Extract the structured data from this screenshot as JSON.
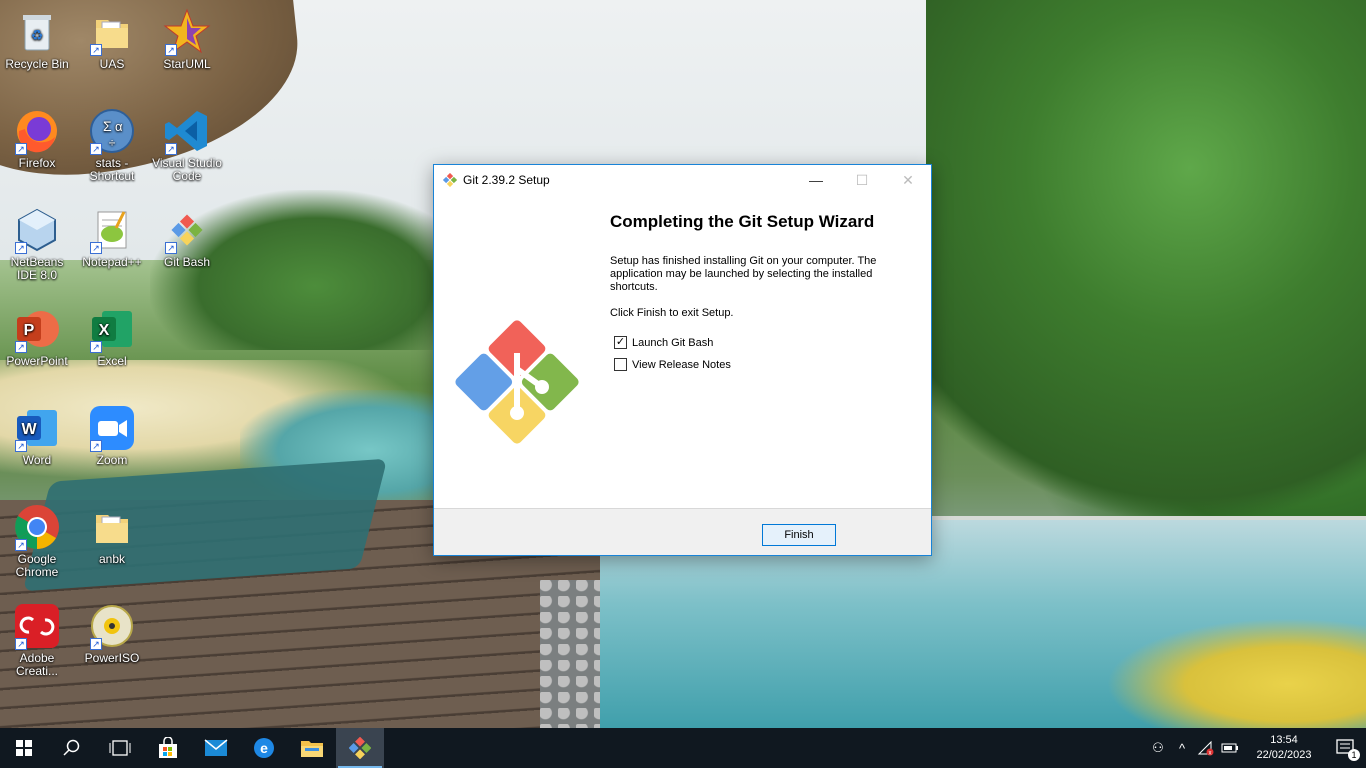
{
  "desktop": {
    "icons": [
      {
        "label": "Recycle Bin",
        "icon": "recycle-bin-icon"
      },
      {
        "label": "UAS",
        "icon": "folder-icon"
      },
      {
        "label": "StarUML",
        "icon": "staruml-icon"
      },
      {
        "label": "Firefox",
        "icon": "firefox-icon"
      },
      {
        "label": "stats - Shortcut",
        "icon": "stats-icon"
      },
      {
        "label": "Visual Studio Code",
        "icon": "vscode-icon"
      },
      {
        "label": "NetBeans IDE 8.0",
        "icon": "netbeans-icon"
      },
      {
        "label": "Notepad++",
        "icon": "notepadpp-icon"
      },
      {
        "label": "Git Bash",
        "icon": "git-bash-icon"
      },
      {
        "label": "PowerPoint",
        "icon": "powerpoint-icon"
      },
      {
        "label": "Excel",
        "icon": "excel-icon"
      },
      {
        "label": "Word",
        "icon": "word-icon"
      },
      {
        "label": "Zoom",
        "icon": "zoom-icon"
      },
      {
        "label": "Google Chrome",
        "icon": "chrome-icon"
      },
      {
        "label": "anbk",
        "icon": "folder-icon"
      },
      {
        "label": "Adobe Creati...",
        "icon": "adobe-cc-icon"
      },
      {
        "label": "PowerISO",
        "icon": "poweriso-icon"
      }
    ]
  },
  "dialog": {
    "title": "Git 2.39.2 Setup",
    "heading": "Completing the Git Setup Wizard",
    "description": "Setup has finished installing Git on your computer. The application may be launched by selecting the installed shortcuts.",
    "instruction": "Click Finish to exit Setup.",
    "options": [
      {
        "label": "Launch Git Bash",
        "checked": true
      },
      {
        "label": "View Release Notes",
        "checked": false
      }
    ],
    "finish_label": "Finish",
    "colors": {
      "accent": "#0078d7",
      "git_red": "#f05a50",
      "git_green": "#7bb342",
      "git_blue": "#5b9ae6",
      "git_yellow": "#f7d35b"
    }
  },
  "taskbar": {
    "items": [
      "windows-start-icon",
      "search-icon",
      "task-view-icon",
      "store-icon",
      "mail-icon",
      "edge-icon",
      "file-explorer-icon",
      "git-setup-icon"
    ],
    "clock": {
      "time": "13:54",
      "date": "22/02/2023"
    },
    "notification_count": "1"
  }
}
